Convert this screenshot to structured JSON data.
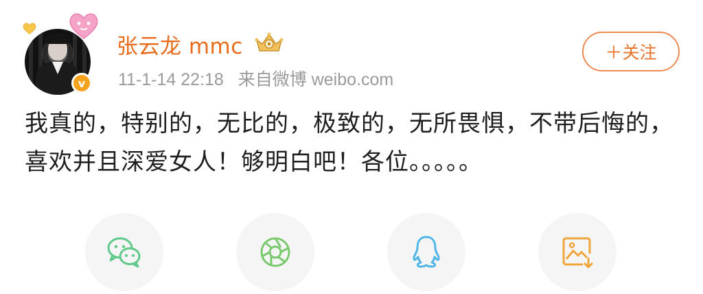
{
  "post": {
    "username": "张云龙 mmc",
    "timestamp": "11-1-14 22:18",
    "source": "来自微博 weibo.com",
    "verified_badge": "v",
    "text": "我真的，特别的，无比的，极致的，无所畏惧，不带后悔的，喜欢并且深爱女人！够明白吧！各位。。。。。",
    "follow_label": "＋关注"
  },
  "colors": {
    "username": "#e86b1c",
    "follow": "#e6732a",
    "wechat": "#5fc98a",
    "moments": "#7bc96f",
    "qq": "#4fb4e6",
    "save": "#f0a53a"
  },
  "share": [
    {
      "icon": "wechat-icon"
    },
    {
      "icon": "moments-icon"
    },
    {
      "icon": "qq-icon"
    },
    {
      "icon": "save-image-icon"
    }
  ]
}
